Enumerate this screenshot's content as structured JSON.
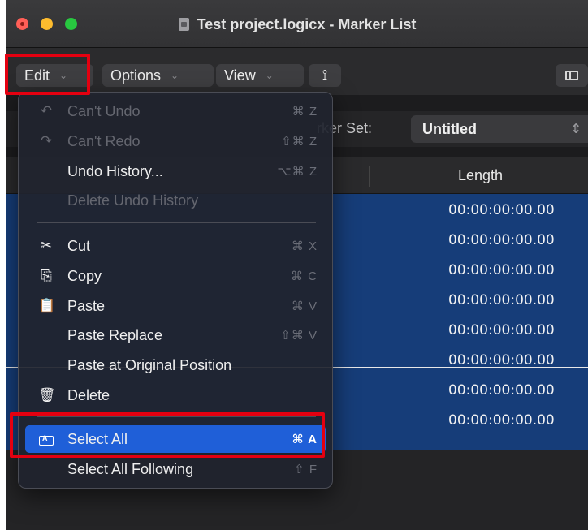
{
  "window": {
    "title": "Test project.logicx - Marker List"
  },
  "toolbar": {
    "edit_label": "Edit",
    "options_label": "Options",
    "view_label": "View",
    "catch_glyph": "⟟",
    "chevron": "⌄"
  },
  "marker_set": {
    "label": "rker Set:",
    "value": "Untitled",
    "updown": "⇕"
  },
  "table": {
    "column_header": "Length",
    "rows": [
      "00:00:00:00.00",
      "00:00:00:00.00",
      "00:00:00:00.00",
      "00:00:00:00.00",
      "00:00:00:00.00",
      "00:00:00:00.00",
      "00:00:00:00.00",
      "00:00:00:00.00"
    ]
  },
  "edit_menu": {
    "items": [
      {
        "label": "Can't Undo",
        "shortcut": "⌘ Z",
        "icon": "↶",
        "enabled": false
      },
      {
        "label": "Can't Redo",
        "shortcut": "⇧⌘ Z",
        "icon": "↷",
        "enabled": false
      },
      {
        "label": "Undo History...",
        "shortcut": "⌥⌘ Z",
        "icon": "",
        "enabled": true
      },
      {
        "label": "Delete Undo History",
        "shortcut": "",
        "icon": "",
        "enabled": false
      },
      {
        "label": "Cut",
        "shortcut": "⌘ X",
        "icon": "✂",
        "enabled": true
      },
      {
        "label": "Copy",
        "shortcut": "⌘ C",
        "icon": "⎘",
        "enabled": true
      },
      {
        "label": "Paste",
        "shortcut": "⌘ V",
        "icon": "📋",
        "enabled": true
      },
      {
        "label": "Paste Replace",
        "shortcut": "⇧⌘ V",
        "icon": "",
        "enabled": true
      },
      {
        "label": "Paste at Original Position",
        "shortcut": "",
        "icon": "",
        "enabled": true
      },
      {
        "label": "Delete",
        "shortcut": "",
        "icon": "🗑",
        "enabled": true
      },
      {
        "label": "Select All",
        "shortcut": "⌘ A",
        "icon": "",
        "enabled": true,
        "highlighted": true
      },
      {
        "label": "Select All Following",
        "shortcut": "⇧ F",
        "icon": "",
        "enabled": true
      }
    ]
  },
  "colors": {
    "highlight": "#1f5fd8",
    "selected_rows": "#163d79",
    "annotation_red": "#e40010"
  }
}
